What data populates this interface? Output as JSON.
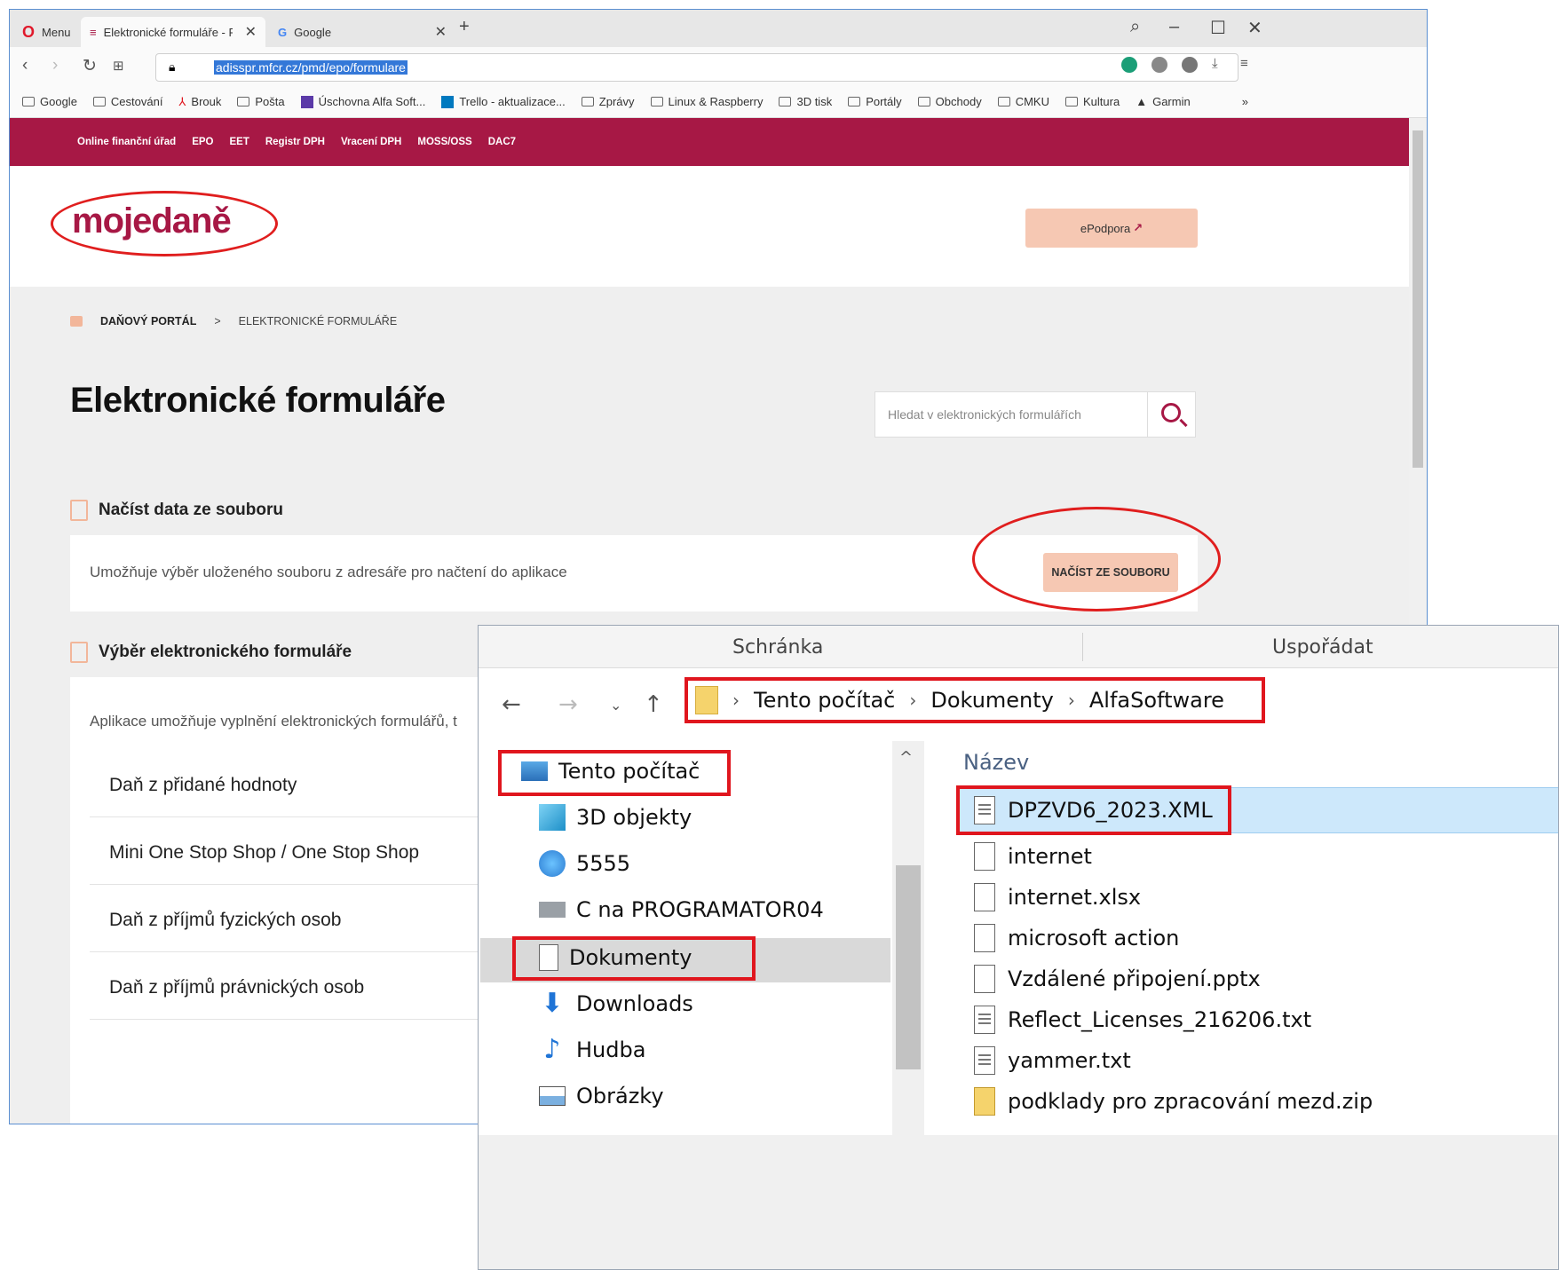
{
  "browser": {
    "menu_label": "Menu",
    "tabs": [
      {
        "title": "Elektronické formuláře - Po",
        "active": true
      },
      {
        "title": "Google",
        "active": false
      }
    ],
    "url": "adisspr.mfcr.cz/pmd/epo/formulare",
    "bookmarks": [
      "Google",
      "Cestování",
      "Brouk",
      "Pošta",
      "Úschovna Alfa Soft...",
      "Trello - aktualizace...",
      "Zprávy",
      "Linux & Raspberry",
      "3D tisk",
      "Portály",
      "Obchody",
      "CMKU",
      "Kultura",
      "Garmin"
    ],
    "bookmarks_more": "»"
  },
  "page": {
    "topnav": [
      "Online finanční úřad",
      "EPO",
      "EET",
      "Registr DPH",
      "Vracení DPH",
      "MOSS/OSS",
      "DAC7"
    ],
    "logo": {
      "part1": "moje",
      "part2": "daně"
    },
    "epodpora": "ePodpora",
    "breadcrumb": {
      "home": "DAŇOVÝ PORTÁL",
      "sep": ">",
      "current": "ELEKTRONICKÉ FORMULÁŘE"
    },
    "title": "Elektronické formuláře",
    "search_placeholder": "Hledat v elektronických formulářích",
    "load_section": {
      "title": "Načíst data ze souboru",
      "description": "Umožňuje výběr uloženého souboru z adresáře pro načtení do aplikace",
      "button": "NAČÍST ZE SOUBORU"
    },
    "select_section": {
      "title": "Výběr elektronického formuláře",
      "description": "Aplikace umožňuje vyplnění elektronických formulářů, t",
      "forms": [
        "Daň z přidané hodnoty",
        "Mini One Stop Shop / One Stop Shop",
        "Daň z příjmů fyzických osob",
        "Daň z příjmů právnických osob"
      ]
    }
  },
  "explorer": {
    "ribbon": [
      "Schránka",
      "Uspořádat"
    ],
    "path": [
      "Tento počítač",
      "Dokumenty",
      "AlfaSoftware"
    ],
    "nav_items": [
      "Tento počítač",
      "3D objekty",
      "5555",
      "C na PROGRAMATOR04",
      "Dokumenty",
      "Downloads",
      "Hudba",
      "Obrázky"
    ],
    "column_header": "Název",
    "files": [
      "DPZVD6_2023.XML",
      "internet",
      "internet.xlsx",
      "microsoft action",
      "Vzdálené připojení.pptx",
      "Reflect_Licenses_216206.txt",
      "yammer.txt",
      "podklady pro zpracování mezd.zip"
    ]
  },
  "colors": {
    "brand": "#a71845",
    "accent_button": "#f6c8b3",
    "highlight": "#e0161e",
    "selection": "#cde8fb"
  }
}
